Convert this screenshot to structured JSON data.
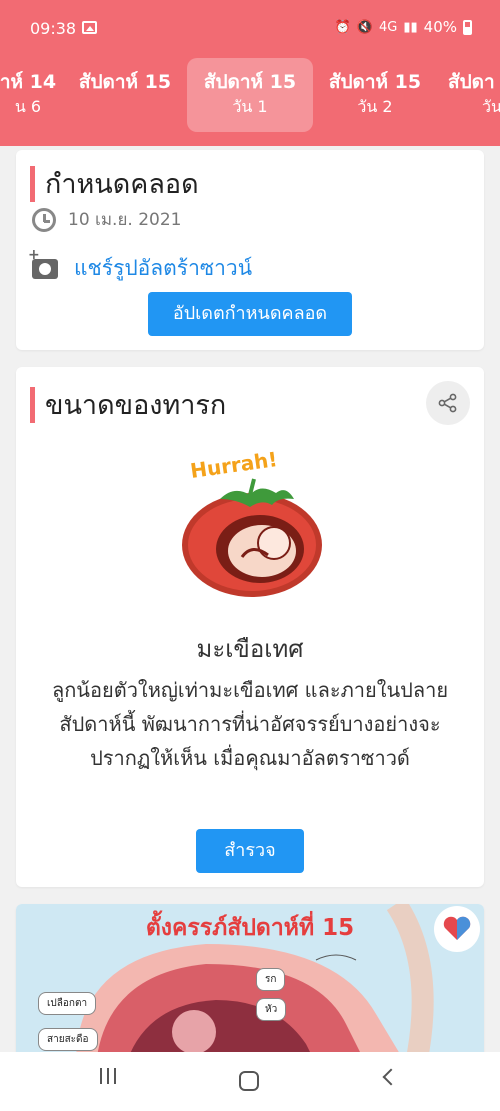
{
  "status_bar": {
    "time": "09:38",
    "network": "4G",
    "battery": "40%"
  },
  "week_tabs": [
    {
      "week": "าห์ 14",
      "day": "น 6"
    },
    {
      "week": "สัปดาห์ 15",
      "day": ""
    },
    {
      "week": "สัปดาห์ 15",
      "day": "วัน 1"
    },
    {
      "week": "สัปดาห์ 15",
      "day": "วัน 2"
    },
    {
      "week": "สัปดา",
      "day": "วัน"
    }
  ],
  "due_date_card": {
    "title": "กำหนดคลอด",
    "date": "10 เม.ย. 2021",
    "share_ultrasound": "แชร์รูปอัลตร้าซาวน์",
    "update_button": "อัปเดตกำหนดคลอด"
  },
  "baby_size_card": {
    "title": "ขนาดของทารก",
    "badge_text": "Hurrah!",
    "fruit_name": "มะเขือเทศ",
    "description": "ลูกน้อยตัวใหญ่เท่ามะเขือเทศ และภายในปลายสัปดาห์นี้ พัฒนาการที่น่าอัศจรรย์บางอย่างจะปรากฏให้เห็น เมื่อคุณมาอัลตราซาวด์",
    "explore_button": "สำรวจ"
  },
  "pregnancy_banner": {
    "title": "ตั้งครรภ์สัปดาห์ที่ 15",
    "labels": [
      "รก",
      "หัว",
      "เปลือกตา",
      "สายสะดือ"
    ]
  },
  "icons": {
    "clock": "clock-icon",
    "camera": "add-photo-icon",
    "share": "share-icon",
    "heart": "heart-icon"
  },
  "colors": {
    "header": "#f26b73",
    "accent": "#2196f3",
    "link": "#1e88e5"
  }
}
